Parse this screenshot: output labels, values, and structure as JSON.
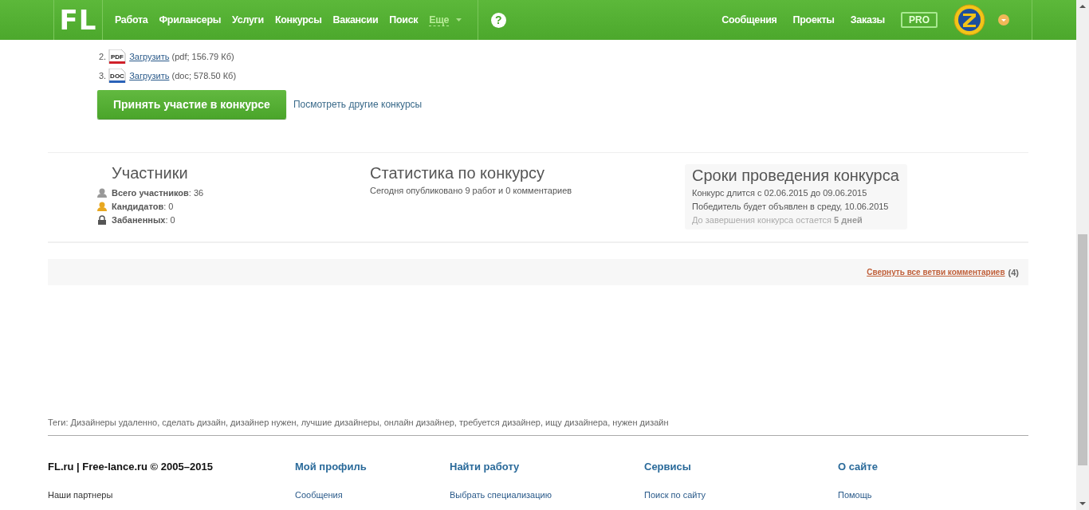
{
  "header": {
    "logo": "FL",
    "nav": [
      {
        "label": "Работа",
        "kind": "link"
      },
      {
        "label": "Фрилансеры",
        "kind": "link"
      },
      {
        "label": "Услуги",
        "kind": "link"
      },
      {
        "label": "Конкурсы",
        "kind": "link"
      },
      {
        "label": "Вакансии",
        "kind": "link"
      },
      {
        "label": "Поиск",
        "kind": "link"
      },
      {
        "label": "Еще",
        "kind": "dropdown"
      }
    ],
    "help": "?",
    "right_nav": [
      "Сообщения",
      "Проекты",
      "Заказы"
    ],
    "pro": "PRO"
  },
  "attachments": [
    {
      "number": "2.",
      "kind": "pdf",
      "icon_text": "PDF",
      "link": "Загрузить",
      "info": "(pdf; 156.79 Кб)"
    },
    {
      "number": "3.",
      "kind": "doc",
      "icon_text": "DOC",
      "link": "Загрузить",
      "info": "(doc; 578.50 Кб)"
    }
  ],
  "actions": {
    "button": "Принять участие в конкурсе",
    "link": "Посмотреть другие конкурсы"
  },
  "participants": {
    "title": "Участники",
    "stats": [
      {
        "kind": "total",
        "text": "**Всего участников**: 36"
      },
      {
        "kind": "candidates",
        "text": "**Кандидатов**: 0"
      },
      {
        "kind": "banned",
        "text": "**Забаненных**: 0"
      }
    ]
  },
  "statistics": {
    "title": "Статистика по конкурсу",
    "text": "Сегодня опубликовано 9 работ и 0 комментариев"
  },
  "dates": {
    "title": "Сроки проведения конкурса",
    "lines": [
      "Конкурс длится с 02.06.2015 до 09.06.2015",
      "Победитель будет объявлен в среду, 10.06.2015"
    ],
    "remaining": "До завершения конкурса остается **5 дней**"
  },
  "comments": {
    "link": "Свернуть все ветви комментариев",
    "count": "(4)"
  },
  "tags": "Теги: Дизайнеры удаленно, сделать дизайн, дизайнер нужен, лучшие дизайнеры, онлайн дизайнер, требуется дизайнер, ищу дизайнера, нужен дизайн",
  "footer": {
    "copyright": "FL.ru | Free-lance.ru © 2005–2015",
    "partners": "Наши партнеры",
    "columns": [
      {
        "title": "Мой профиль",
        "links": [
          "Сообщения"
        ]
      },
      {
        "title": "Найти работу",
        "links": [
          "Выбрать специализацию"
        ]
      },
      {
        "title": "Сервисы",
        "links": [
          "Поиск по сайту"
        ]
      },
      {
        "title": "О сайте",
        "links": [
          "Помощь"
        ]
      }
    ]
  }
}
